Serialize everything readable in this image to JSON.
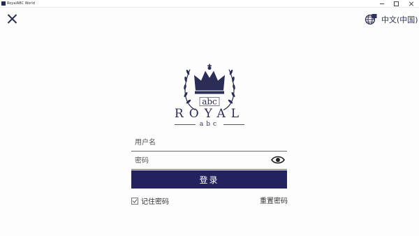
{
  "window": {
    "title": "RoyalABC World"
  },
  "language": {
    "label": "中文(中国)"
  },
  "brand": {
    "name": "ROYAL",
    "sub": "abc",
    "logo_text": "abc"
  },
  "form": {
    "username_placeholder": "用户名",
    "password_placeholder": "密码",
    "login_label": "登录",
    "remember_label": "记住密码",
    "remember_checked": true,
    "reset_label": "重置密码"
  },
  "colors": {
    "brand": "#23225e",
    "background": "#fdfdfd"
  },
  "icons": [
    "close-icon",
    "language-icon",
    "eye-icon",
    "crown-logo"
  ]
}
